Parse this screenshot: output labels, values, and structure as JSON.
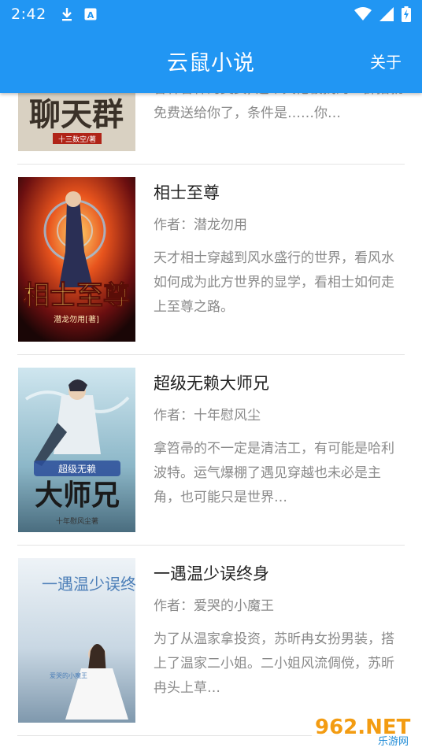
{
  "status_bar": {
    "time": "2:42",
    "icons": [
      "download-icon",
      "text-a-icon",
      "wifi-icon",
      "signal-icon",
      "battery-charging-icon"
    ]
  },
  "app_bar": {
    "title": "云鼠小说",
    "about_label": "关于"
  },
  "books": [
    {
      "title": "",
      "author_prefix": "",
      "author": "",
      "description": "各种各样的美女, 这个大佬被找的一群指就免费送给你了，条件是……你…",
      "cover_text": "聊天群",
      "cover_author": "十三数空/著"
    },
    {
      "title": "相士至尊",
      "author_prefix": "作者：",
      "author": "潜龙勿用",
      "description": "天才相士穿越到风水盛行的世界，看风水如何成为此方世界的显学，看相士如何走上至尊之路。",
      "cover_text": "相士至尊",
      "cover_author": "潜龙勿用[著]"
    },
    {
      "title": "超级无赖大师兄",
      "author_prefix": "作者：",
      "author": "十年慰风尘",
      "description": "拿笤帚的不一定是清洁工，有可能是哈利波特。运气爆棚了遇见穿越也未必是主角，也可能只是世界…",
      "cover_text": "大师兄",
      "cover_subtext": "超级无赖",
      "cover_author": "十年慰风尘著"
    },
    {
      "title": "一遇温少误终身",
      "author_prefix": "作者：",
      "author": "爱哭的小魔王",
      "description": "为了从温家拿投资，苏昕冉女扮男装，搭上了温家二小姐。二小姐风流倜傥，苏昕冉头上草…",
      "cover_text": "一遇温少误终身",
      "cover_author": "爱哭的小魔王"
    }
  ],
  "watermark": {
    "top": "962.NET",
    "bottom": "乐游网"
  },
  "colors": {
    "primary": "#2196F3",
    "title_text": "#222222",
    "secondary_text": "#8a8a8a",
    "divider": "#e4e4e4"
  }
}
